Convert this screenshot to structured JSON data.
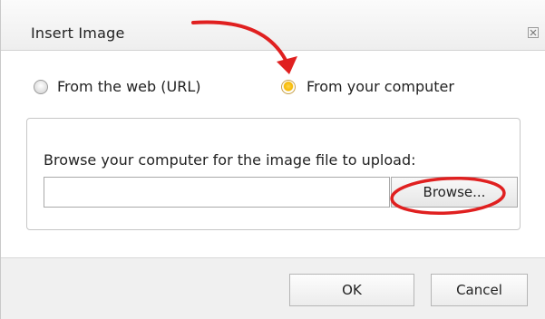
{
  "dialog": {
    "title": "Insert Image",
    "close_icon": "close-icon"
  },
  "source_options": [
    {
      "label": "From the web (URL)",
      "selected": false
    },
    {
      "label": "From your computer",
      "selected": true
    }
  ],
  "upload": {
    "instruction": "Browse your computer for the image file to upload:",
    "file_value": "",
    "browse_label": "Browse..."
  },
  "footer": {
    "ok_label": "OK",
    "cancel_label": "Cancel"
  },
  "colors": {
    "selected_radio": "#f5b800",
    "annotation": "#e02020"
  }
}
